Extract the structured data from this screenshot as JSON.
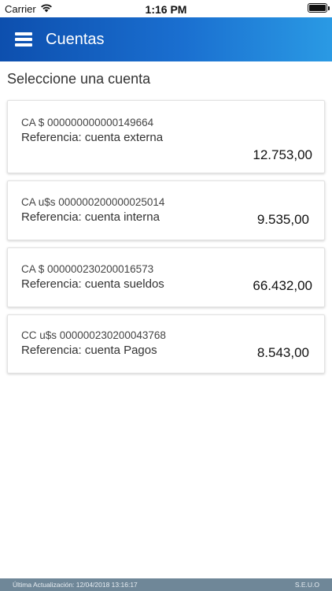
{
  "status_bar": {
    "carrier": "Carrier",
    "time": "1:16 PM",
    "wifi_icon": "wifi-icon",
    "battery_icon": "battery-icon"
  },
  "header": {
    "menu_icon": "menu-icon",
    "title": "Cuentas",
    "gradient_colors": [
      "#0d4fae",
      "#2a9ae4"
    ]
  },
  "main": {
    "section_title": "Seleccione una cuenta",
    "accounts": [
      {
        "number": "CA $ 000000000000149664",
        "reference": "Referencia: cuenta externa",
        "balance": "12.753,00"
      },
      {
        "number": "CA u$s 000000200000025014",
        "reference": "Referencia: cuenta interna",
        "balance": "9.535,00"
      },
      {
        "number": "CA $ 000000230200016573",
        "reference": "Referencia: cuenta sueldos",
        "balance": "66.432,00"
      },
      {
        "number": "CC u$s 000000230200043768",
        "reference": "Referencia: cuenta Pagos",
        "balance": "8.543,00"
      }
    ]
  },
  "footer": {
    "last_update": "Última Actualización: 12/04/2018 13:16:17",
    "brand": "S.E.U.O",
    "background_color": "#6f8798"
  }
}
